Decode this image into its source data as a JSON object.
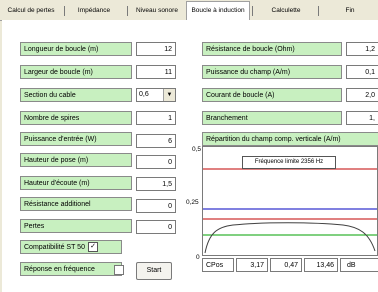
{
  "tabs": [
    {
      "label": "Calcul de pertes"
    },
    {
      "label": "Impédance"
    },
    {
      "label": "Niveau sonore"
    },
    {
      "label": "Boucle à induction"
    },
    {
      "label": "Calculette"
    },
    {
      "label": "Fin"
    }
  ],
  "left_fields": [
    {
      "label": "Longueur de boucle (m)",
      "value": "12"
    },
    {
      "label": "Largeur de boucle (m)",
      "value": "11"
    },
    {
      "label": "Section du cable",
      "value": "0,6"
    },
    {
      "label": "Nombre de spires",
      "value": "1"
    },
    {
      "label": "Puissance d'entrée (W)",
      "value": "6"
    },
    {
      "label": "Hauteur de pose (m)",
      "value": "0"
    },
    {
      "label": "Hauteur d'écoute (m)",
      "value": "1,5"
    },
    {
      "label": "Résistance additionel",
      "value": "0"
    },
    {
      "label": "Pertes",
      "value": "0"
    }
  ],
  "compat_label": "Compatibilité ST 50",
  "compat_checked": "✓",
  "reponse_label": "Réponse en fréquence",
  "start_label": "Start",
  "right_fields": [
    {
      "label": "Résistance de boucle (Ohm)",
      "value": "1,2"
    },
    {
      "label": "Puissance du champ (A/m)",
      "value": "0,1"
    },
    {
      "label": "Courant de boucle (A)",
      "value": "2,0"
    },
    {
      "label": "Branchement",
      "value": "1,"
    }
  ],
  "repartition_label": "Répartition du champ comp. verticale (A/m)",
  "graph": {
    "y_ticks": [
      "0,5",
      "0,25",
      "0"
    ],
    "legend": "Fréquence limite   2356  Hz",
    "line_colors": [
      "#c00000",
      "#0000c0",
      "#00a000",
      "#404040"
    ]
  },
  "status": {
    "label": "CPos",
    "v1": "3,17",
    "v2": "0,47",
    "v3": "13,46",
    "unit": "dB"
  }
}
